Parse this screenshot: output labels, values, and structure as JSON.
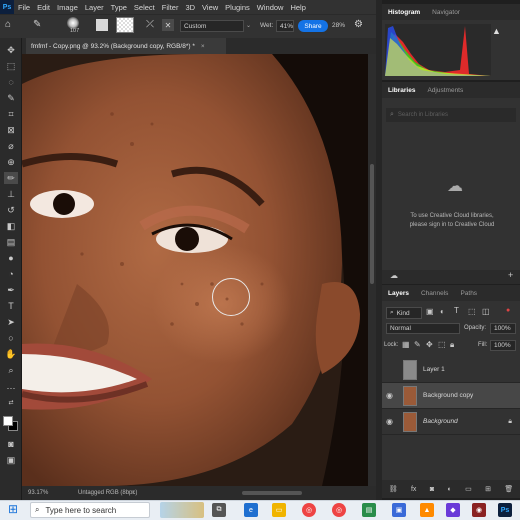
{
  "app": {
    "logo": "Ps"
  },
  "menu": [
    "File",
    "Edit",
    "Image",
    "Layer",
    "Type",
    "Select",
    "Filter",
    "3D",
    "View",
    "Plugins",
    "Window",
    "Help"
  ],
  "options": {
    "brush_size": "107",
    "mode": "Custom",
    "wet_label": "Wet:",
    "wet_value": "41%",
    "share": "Share",
    "pct": "28%"
  },
  "document": {
    "tab_title": "fmfmf - Copy.png @ 93.2% (Background copy, RGB/8*) *"
  },
  "status": {
    "zoom": "93.17%",
    "profile": "Untagged RGB (8bpc)"
  },
  "panels": {
    "histogram_tabs": [
      "Histogram",
      "Navigator"
    ],
    "libraries_tabs": [
      "Libraries",
      "Adjustments"
    ],
    "libraries_search_placeholder": "Search in Libraries",
    "libraries_message": "To use Creative Cloud libraries, please sign in to Creative Cloud",
    "layers_tabs": [
      "Layers",
      "Channels",
      "Paths"
    ],
    "kind": "Kind",
    "blend_mode": "Normal",
    "opacity_label": "Opacity:",
    "opacity_value": "100%",
    "lock_label": "Lock:",
    "fill_label": "Fill:",
    "fill_value": "100%",
    "layers": [
      {
        "name": "Layer 1",
        "visible": false,
        "selected": false
      },
      {
        "name": "Background copy",
        "visible": true,
        "selected": true
      },
      {
        "name": "Background",
        "visible": true,
        "selected": false
      }
    ],
    "footer_fx": "fx"
  },
  "taskbar": {
    "search_placeholder": "Type here to search"
  },
  "colors": {
    "accent": "#1473e6",
    "panel": "#323232",
    "bg": "#1e1e1e"
  }
}
